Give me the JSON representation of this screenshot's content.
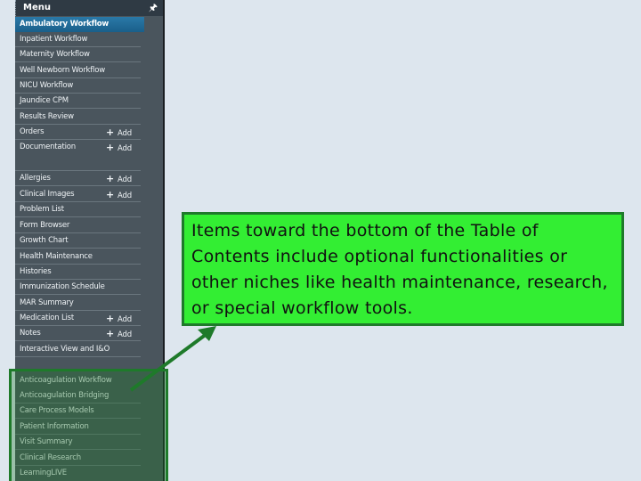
{
  "menu": {
    "title": "Menu",
    "pin_icon": "pin-icon",
    "items": [
      {
        "label": "Ambulatory Workflow",
        "selected": true
      },
      {
        "label": "Inpatient Workflow"
      },
      {
        "label": "Maternity Workflow"
      },
      {
        "label": "Well Newborn Workflow"
      },
      {
        "label": "NICU Workflow"
      },
      {
        "label": "Jaundice CPM"
      },
      {
        "label": "Results Review"
      },
      {
        "label": "Orders",
        "action": "Add"
      },
      {
        "label": "Documentation",
        "action": "Add"
      },
      {
        "label": "Allergies",
        "action": "Add"
      },
      {
        "label": "Clinical Images",
        "action": "Add"
      },
      {
        "label": "Problem List"
      },
      {
        "label": "Form Browser"
      },
      {
        "label": "Growth Chart"
      },
      {
        "label": "Health Maintenance"
      },
      {
        "label": "Histories"
      },
      {
        "label": "Immunization Schedule"
      },
      {
        "label": "MAR Summary"
      },
      {
        "label": "Medication List",
        "action": "Add"
      },
      {
        "label": "Notes",
        "action": "Add"
      },
      {
        "label": "Interactive View and I&O"
      },
      {
        "label": "Anticoagulation Workflow"
      },
      {
        "label": "Anticoagulation Bridging"
      },
      {
        "label": "Care Process Models"
      },
      {
        "label": "Patient Information"
      },
      {
        "label": "Visit Summary"
      },
      {
        "label": "Clinical Research"
      },
      {
        "label": "LearningLIVE"
      }
    ]
  },
  "callout": {
    "text": "Items toward the bottom of the Table of Contents include optional functionalities or other niches like health maintenance, research, or special workflow tools."
  },
  "colors": {
    "panel": "#4a555d",
    "selected": "#1f6a96",
    "highlight_border": "#1e7a2a",
    "callout_bg": "#33ee33"
  }
}
